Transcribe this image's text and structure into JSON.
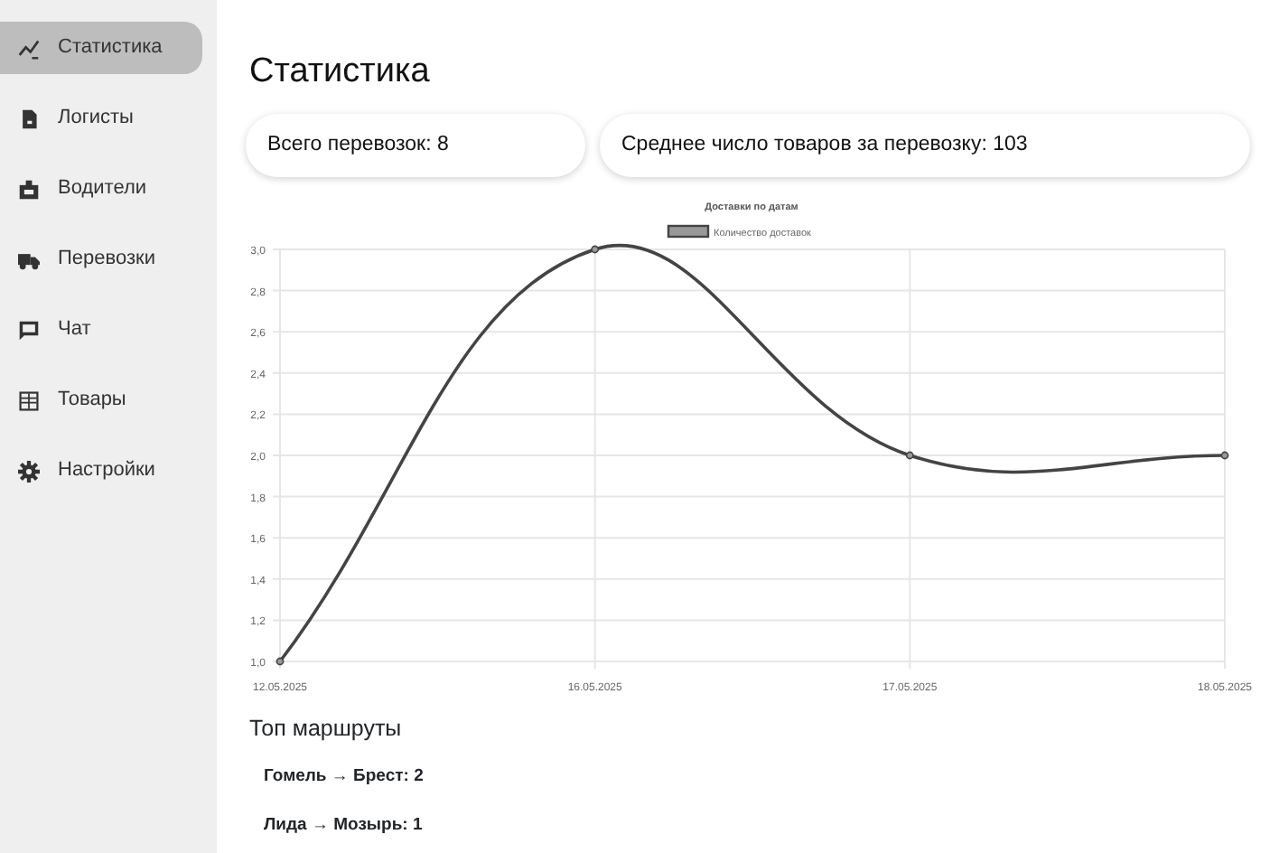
{
  "sidebar": {
    "items": [
      {
        "label": "Статистика",
        "selected": true
      },
      {
        "label": "Логисты",
        "selected": false
      },
      {
        "label": "Водители",
        "selected": false
      },
      {
        "label": "Перевозки",
        "selected": false
      },
      {
        "label": "Чат",
        "selected": false
      },
      {
        "label": "Товары",
        "selected": false
      },
      {
        "label": "Настройки",
        "selected": false
      }
    ]
  },
  "title": "Статистика",
  "summary": [
    {
      "text": "Всего перевозок: 8"
    },
    {
      "text": "Среднее число товаров за перевозку: 103"
    }
  ],
  "chart": {
    "chart_data": {
      "type": "line",
      "title": "Доставки по датам",
      "categories": [
        "12.05.2025",
        "16.05.2025",
        "17.05.2025",
        "18.05.2025"
      ],
      "series": [
        {
          "name": "Количество доставок",
          "color": "#444444",
          "marker": true,
          "values": [
            1,
            3,
            2,
            2
          ]
        }
      ],
      "grid": true,
      "ylim": [
        1,
        3
      ],
      "yticks": [
        {
          "value": 1,
          "label": "1,0"
        },
        {
          "value": 1.2,
          "label": "1,2"
        },
        {
          "value": 1.4,
          "label": "1,4"
        },
        {
          "value": 1.6,
          "label": "1,6"
        },
        {
          "value": 1.8,
          "label": "1,8"
        },
        {
          "value": 2,
          "label": "2,0"
        },
        {
          "value": 2.2,
          "label": "2,2"
        },
        {
          "value": 2.4,
          "label": "2,4"
        },
        {
          "value": 2.6,
          "label": "2,6"
        },
        {
          "value": 2.8,
          "label": "2,8"
        },
        {
          "value": 3,
          "label": "3,0"
        }
      ]
    }
  },
  "routes": {
    "title": "Топ маршруты",
    "items": [
      {
        "text": "Гомель → Брест: 2"
      },
      {
        "text": "Лида → Мозырь: 1"
      }
    ]
  }
}
